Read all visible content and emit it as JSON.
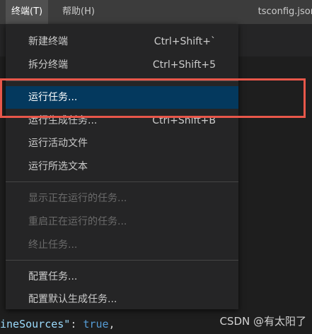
{
  "menubar": {
    "items": [
      {
        "label": "终端(T)",
        "active": true
      },
      {
        "label": "帮助(H)",
        "active": false
      }
    ],
    "filename": "tsconfig.json"
  },
  "editor": {
    "code_line": {
      "key": "ineSources\"",
      "colon": ": ",
      "value": "true",
      "comma": ","
    }
  },
  "menu": {
    "groups": [
      [
        {
          "label": "新建终端",
          "shortcut": "Ctrl+Shift+`"
        },
        {
          "label": "拆分终端",
          "shortcut": "Ctrl+Shift+5"
        }
      ],
      [
        {
          "label": "运行任务...",
          "shortcut": "",
          "selected": true
        },
        {
          "label": "运行生成任务...",
          "shortcut": "Ctrl+Shift+B"
        },
        {
          "label": "运行活动文件",
          "shortcut": ""
        },
        {
          "label": "运行所选文本",
          "shortcut": ""
        }
      ],
      [
        {
          "label": "显示正在运行的任务...",
          "shortcut": "",
          "disabled": true
        },
        {
          "label": "重启正在运行的任务...",
          "shortcut": "",
          "disabled": true
        },
        {
          "label": "终止任务...",
          "shortcut": "",
          "disabled": true
        }
      ],
      [
        {
          "label": "配置任务...",
          "shortcut": ""
        },
        {
          "label": "配置默认生成任务...",
          "shortcut": ""
        }
      ]
    ]
  },
  "watermark": "CSDN @有太阳了",
  "colors": {
    "menu_bg": "#252526",
    "selected_bg": "#04395e",
    "highlight_border": "#e8574a",
    "menubar_bg": "#3c3c3c"
  }
}
